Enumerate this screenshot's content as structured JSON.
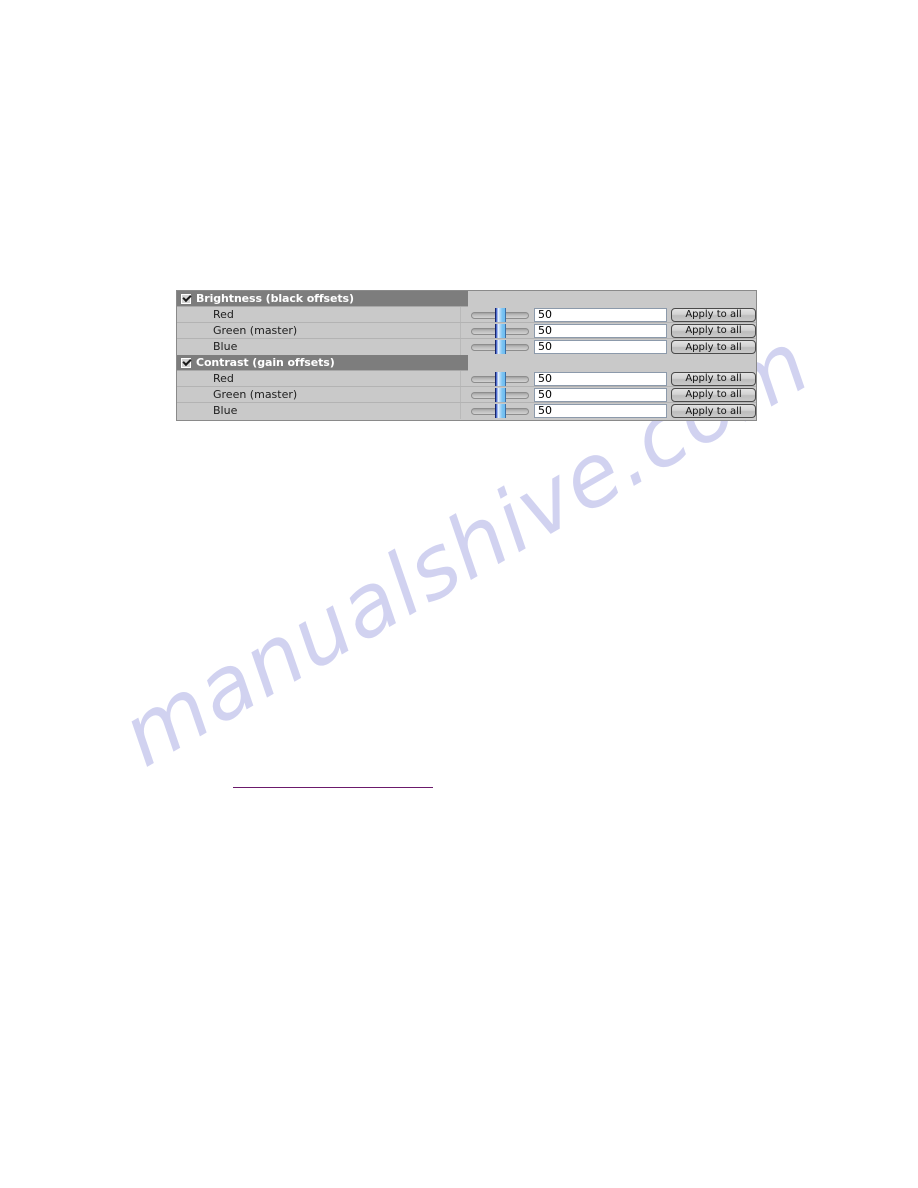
{
  "panel": {
    "name": "display-adjustment-panel",
    "groups": [
      {
        "id": "brightness",
        "title": "Brightness (black offsets)",
        "enabled": true,
        "checkbox_icon": "checkbox-checked-icon",
        "rows": [
          {
            "label": "Red",
            "value": "50",
            "slider_icon": "slider-handle-icon",
            "button": "Apply to all"
          },
          {
            "label": "Green (master)",
            "value": "50",
            "slider_icon": "slider-handle-icon",
            "button": "Apply to all"
          },
          {
            "label": "Blue",
            "value": "50",
            "slider_icon": "slider-handle-icon",
            "button": "Apply to all"
          }
        ]
      },
      {
        "id": "contrast",
        "title": "Contrast (gain offsets)",
        "enabled": true,
        "checkbox_icon": "checkbox-checked-icon",
        "rows": [
          {
            "label": "Red",
            "value": "50",
            "slider_icon": "slider-handle-icon",
            "button": "Apply to all"
          },
          {
            "label": "Green (master)",
            "value": "50",
            "slider_icon": "slider-handle-icon",
            "button": "Apply to all"
          },
          {
            "label": "Blue",
            "value": "50",
            "slider_icon": "slider-handle-icon",
            "button": "Apply to all"
          }
        ]
      }
    ]
  },
  "watermark": {
    "text": "manualshive.com",
    "color": "#c9cbee"
  },
  "colors": {
    "panel_background": "#c9c9c9",
    "group_header_background": "#7d7d7d",
    "group_header_text": "#ffffff",
    "slider_thumb_accent": "#6fbdf0",
    "input_background": "#ffffff",
    "rule_color": "#6b1a6b"
  }
}
